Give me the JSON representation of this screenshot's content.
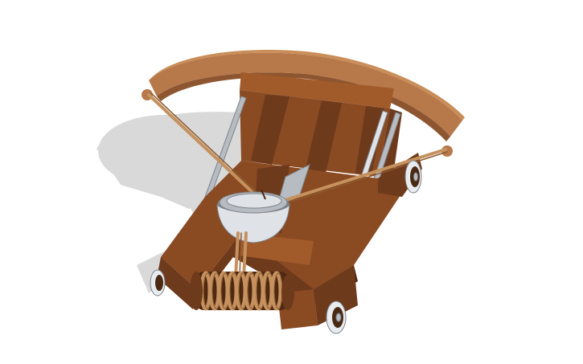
{
  "scene": {
    "subject": "ballista-catapult-3d-model",
    "background_color": "#ffffff",
    "shadow_color": "#d9d9d9",
    "colors": {
      "wood_dark": "#6e3a1c",
      "wood_mid": "#8a4a22",
      "wood_light": "#a15a2a",
      "wood_shadow": "#4e2810",
      "bow_light": "#c98d58",
      "bow_mid": "#b8794a",
      "bow_dark": "#8e5630",
      "rope": "#c5925f",
      "rope_dark": "#8c5a30",
      "metal_light": "#dfe2e6",
      "metal_mid": "#b7bcc2",
      "metal_dark": "#7d838a",
      "wheel_rim": "#e9ecef",
      "wheel_hub": "#4b2a14"
    }
  }
}
